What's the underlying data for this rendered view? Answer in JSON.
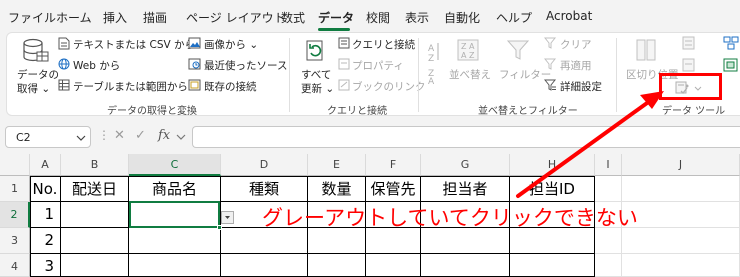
{
  "menu": {
    "tabs": [
      "ファイル",
      "ホーム",
      "挿入",
      "描画",
      "ページ レイアウト",
      "数式",
      "データ",
      "校閲",
      "表示",
      "自動化",
      "ヘルプ",
      "Acrobat"
    ],
    "active": "データ"
  },
  "ribbon": {
    "get_data": {
      "line1": "データの",
      "line2": "取得 ⌄"
    },
    "from_text_csv": "テキストまたは CSV から",
    "from_web": "Web から",
    "from_table": "テーブルまたは範囲から",
    "from_image": "画像から ⌄",
    "recent_sources": "最近使ったソース",
    "existing_connections": "既存の接続",
    "group_get_transform": "データの取得と変換",
    "refresh_all": {
      "line1": "すべて",
      "line2": "更新 ⌄"
    },
    "queries_connections": "クエリと接続",
    "properties": "プロパティ",
    "edit_links": "ブックのリンク",
    "group_queries": "クエリと接続",
    "sort": "並べ替え",
    "filter": "フィルター",
    "clear": "クリア",
    "reapply": "再適用",
    "advanced": "詳細設定",
    "group_sort_filter": "並べ替えとフィルター",
    "text_to_columns": "区切り位置",
    "group_data_tools": "データ ツール"
  },
  "formula_bar": {
    "name_box": "C2",
    "formula": ""
  },
  "sheet": {
    "columns": [
      "A",
      "B",
      "C",
      "D",
      "E",
      "F",
      "G",
      "H",
      "I",
      "J"
    ],
    "rows": [
      "1",
      "2",
      "3",
      "4"
    ],
    "selected_column": "C",
    "selected_row": "2",
    "headers": [
      "No.",
      "配送日",
      "商品名",
      "種類",
      "数量",
      "保管先",
      "担当者",
      "担当ID"
    ],
    "no_values": [
      "1",
      "2",
      "3"
    ]
  },
  "annotation": {
    "text": "グレーアウトしていてクリックできない",
    "color": "#ff0000"
  },
  "colors": {
    "accent": "#107c41",
    "annotation": "#ff0000",
    "disabled": "#a6a6a6"
  }
}
